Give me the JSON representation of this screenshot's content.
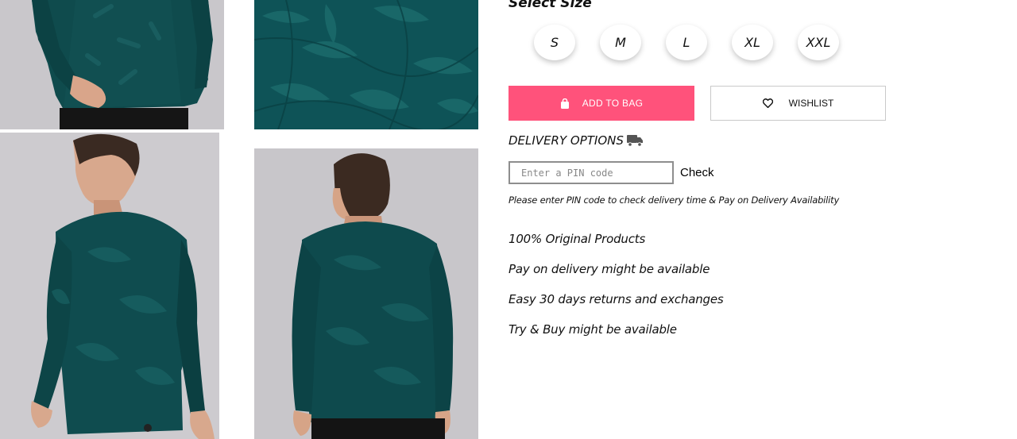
{
  "size_selector": {
    "title": "Select Size",
    "sizes": [
      "S",
      "M",
      "L",
      "XL",
      "XXL"
    ]
  },
  "actions": {
    "add_to_bag_label": "ADD TO BAG",
    "wishlist_label": "WISHLIST",
    "accent_color": "#ff527b"
  },
  "delivery": {
    "title": "DELIVERY OPTIONS",
    "pin_placeholder": "Enter a PIN code",
    "check_label": "Check",
    "note": "Please enter PIN code to check delivery time & Pay on Delivery Availability"
  },
  "features": [
    "100% Original Products",
    "Pay on delivery might be available",
    "Easy 30 days returns and exchanges",
    "Try & Buy might be available"
  ],
  "icons": {
    "bag": "shopping-bag-icon",
    "wishlist": "heart-icon",
    "delivery": "truck-icon"
  }
}
